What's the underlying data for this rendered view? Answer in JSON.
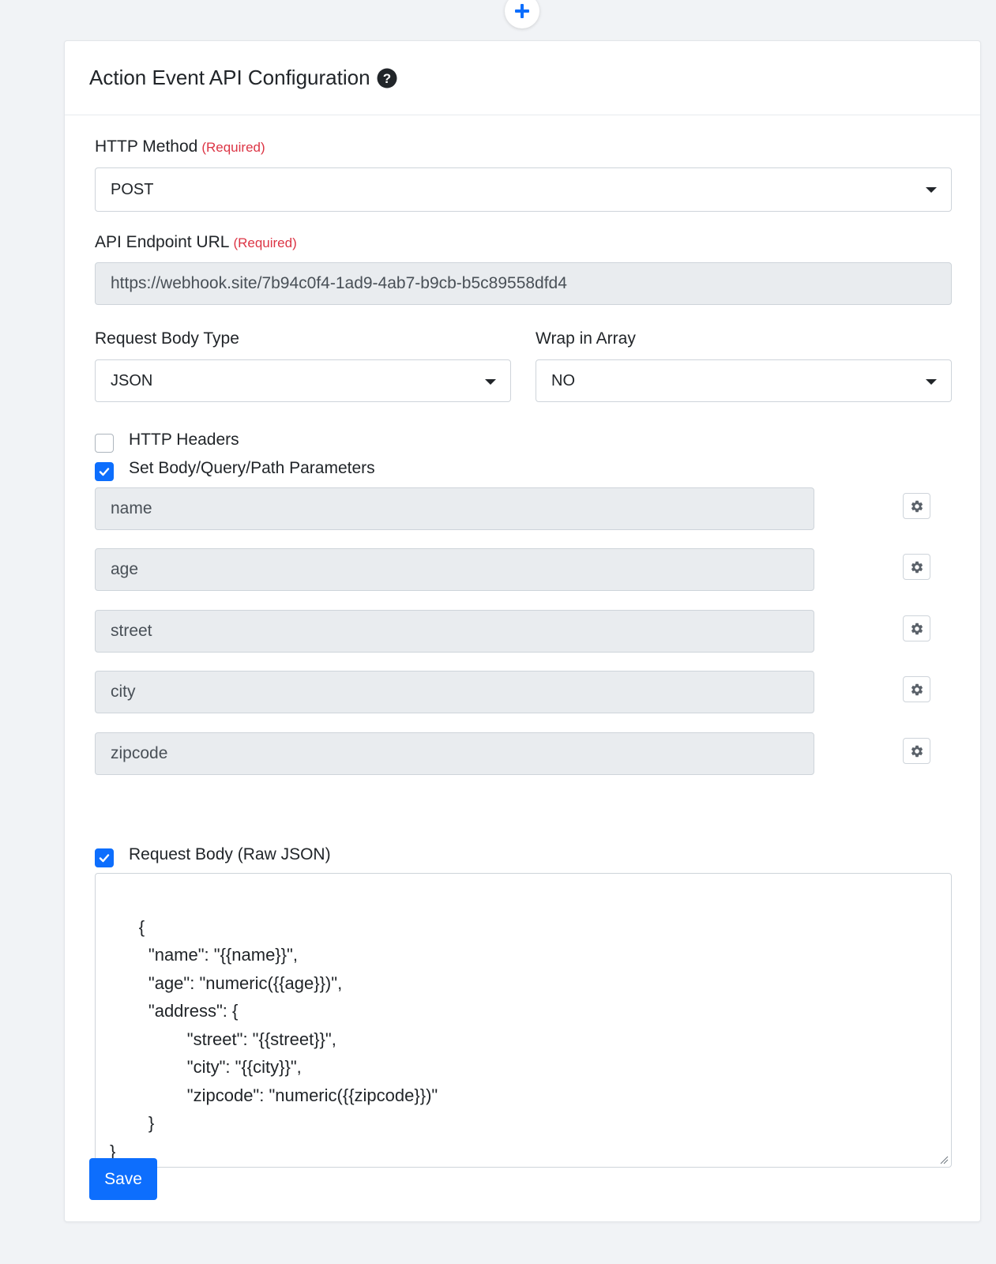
{
  "add_step": {
    "icon": "plus-icon"
  },
  "card": {
    "title": "Action Event API Configuration",
    "help_icon": "question-circle-icon"
  },
  "http_method": {
    "label": "HTTP Method",
    "required": "(Required)",
    "value": "POST"
  },
  "api_endpoint": {
    "label": "API Endpoint URL",
    "required": "(Required)",
    "value": "https://webhook.site/7b94c0f4-1ad9-4ab7-b9cb-b5c89558dfd4"
  },
  "request_body_type": {
    "label": "Request Body Type",
    "value": "JSON"
  },
  "wrap_in_array": {
    "label": "Wrap in Array",
    "value": "NO"
  },
  "http_headers": {
    "label": "HTTP Headers",
    "checked": false
  },
  "parameters": {
    "label": "Set Body/Query/Path Parameters",
    "checked": true,
    "items": [
      {
        "name": "name"
      },
      {
        "name": "age"
      },
      {
        "name": "street"
      },
      {
        "name": "city"
      },
      {
        "name": "zipcode"
      }
    ]
  },
  "raw_json": {
    "label": "Request Body (Raw JSON)",
    "checked": true,
    "value": "{\n        \"name\": \"{{name}}\",\n        \"age\": \"numeric({{age}})\",\n        \"address\": {\n                \"street\": \"{{street}}\",\n                \"city\": \"{{city}}\",\n                \"zipcode\": \"numeric({{zipcode}})\"\n        }\n}"
  },
  "save_label": "Save",
  "colors": {
    "primary": "#0d6efd",
    "required": "#dc3545",
    "readonly_bg": "#e9ecef",
    "page_bg": "#f1f3f6"
  }
}
